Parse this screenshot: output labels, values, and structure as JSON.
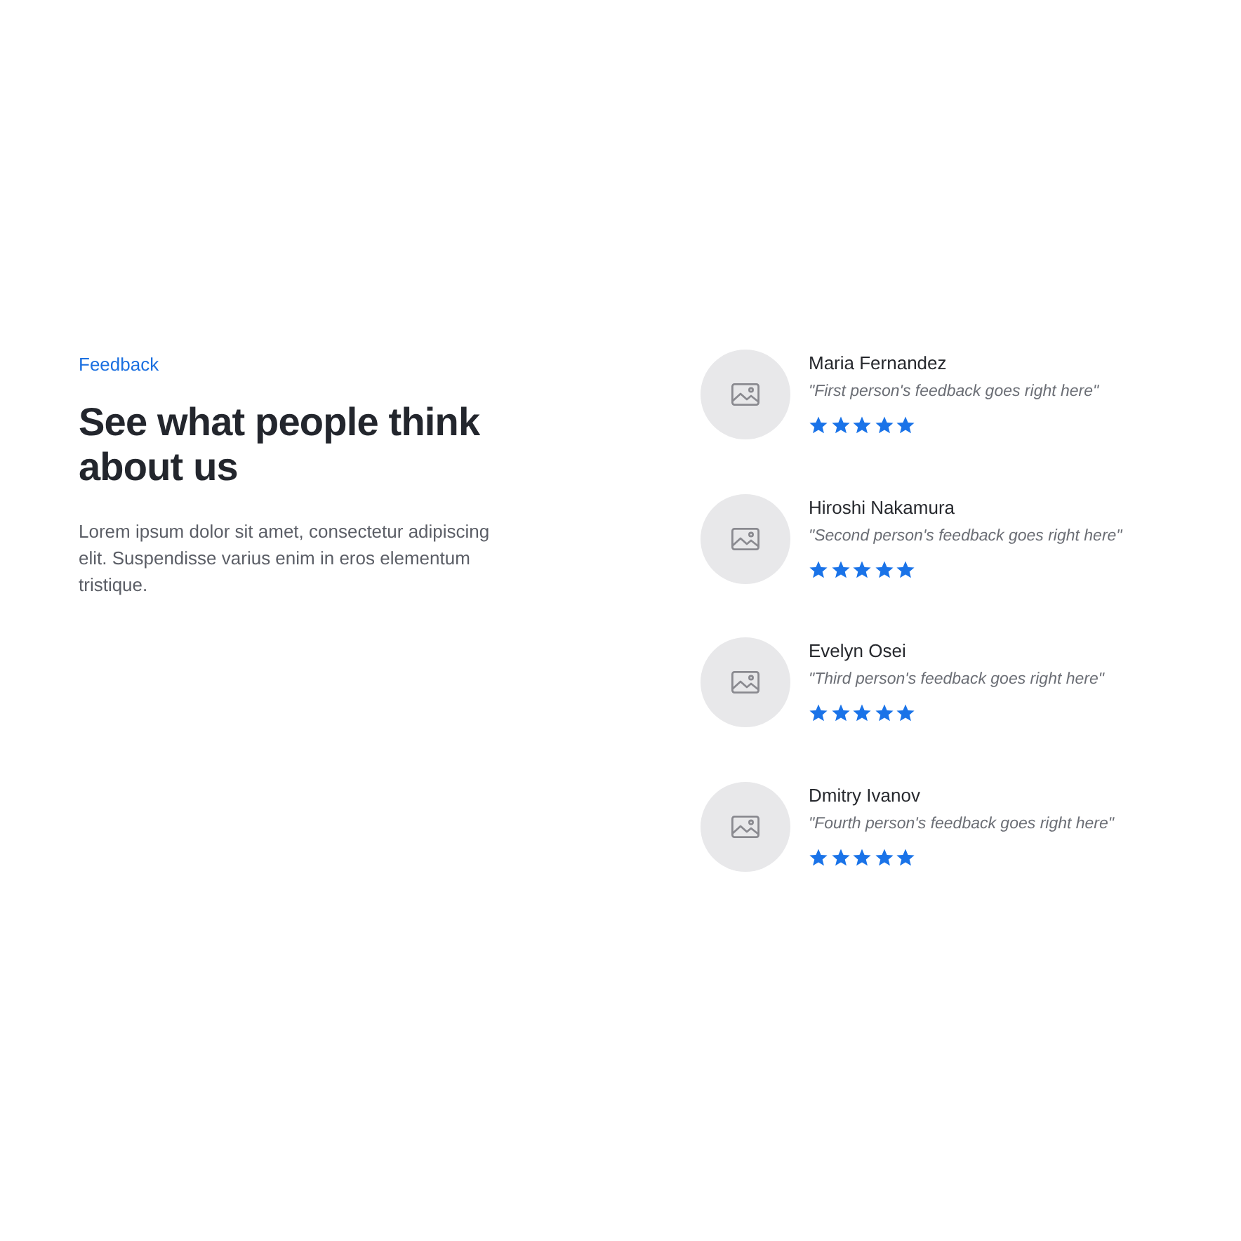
{
  "section": {
    "eyebrow": "Feedback",
    "heading": "See what people think about us",
    "description": "Lorem ipsum dolor sit amet, consectetur adipiscing elit. Suspendisse varius enim in eros elementum tristique."
  },
  "testimonials": [
    {
      "name": "Maria Fernandez",
      "quote": "\"First person's feedback goes right here\"",
      "stars": 5
    },
    {
      "name": "Hiroshi Nakamura",
      "quote": "\"Second person's feedback goes right here\"",
      "stars": 5
    },
    {
      "name": "Evelyn Osei",
      "quote": "\"Third person's feedback goes right here\"",
      "stars": 5
    },
    {
      "name": "Dmitry Ivanov",
      "quote": "\"Fourth person's feedback goes right here\"",
      "stars": 5
    }
  ]
}
